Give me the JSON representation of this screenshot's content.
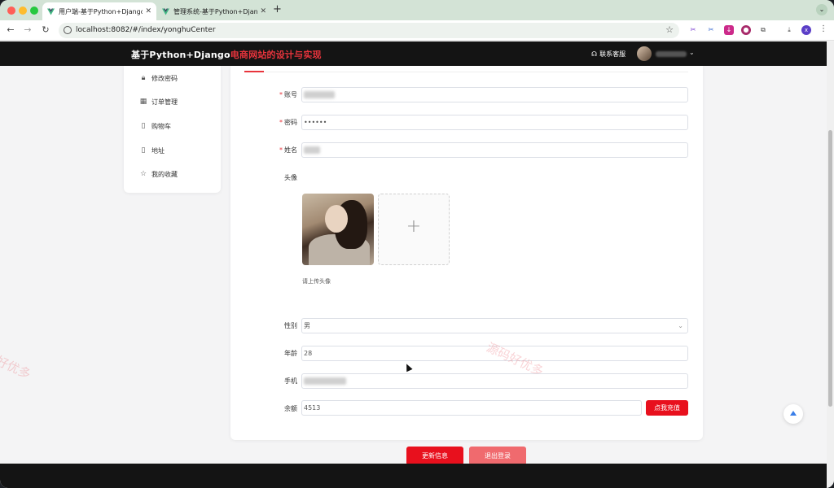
{
  "browser": {
    "tabs": [
      {
        "label": "用户端-基于Python+Django电",
        "close": "✕"
      },
      {
        "label": "管理系统-基于Python+Django",
        "close": "✕"
      }
    ],
    "new_tab": "+",
    "url": "localhost:8082/#/index/yonghuCenter"
  },
  "header": {
    "title_part1": "基于Python+Django",
    "title_part2": "电商网站的设计与实现",
    "support_label": "联系客服"
  },
  "sidebar": {
    "items": [
      {
        "label": "修改密码",
        "icon": "lock-icon"
      },
      {
        "label": "订单管理",
        "icon": "grid-icon"
      },
      {
        "label": "购物车",
        "icon": "bookmark-icon"
      },
      {
        "label": "地址",
        "icon": "bookmark-icon"
      },
      {
        "label": "我的收藏",
        "icon": "star-icon"
      }
    ]
  },
  "form": {
    "account_label": "账号",
    "password_label": "密码",
    "password_value": "••••••",
    "name_label": "姓名",
    "avatar_label": "头像",
    "avatar_hint": "请上传头像",
    "upload_plus": "+",
    "gender_label": "性别",
    "gender_value": "男",
    "age_label": "年龄",
    "age_value": "28",
    "phone_label": "手机",
    "balance_label": "余额",
    "balance_value": "4513",
    "recharge_button": "点我充值",
    "update_button": "更新信息",
    "logout_button": "退出登录"
  },
  "watermark": {
    "text": "源码好优多",
    "fragment": "好优多"
  },
  "colors": {
    "accent": "#e8101d",
    "accent_light": "#f06a6e",
    "header_bg": "#141414",
    "title_red": "#e8343c"
  }
}
